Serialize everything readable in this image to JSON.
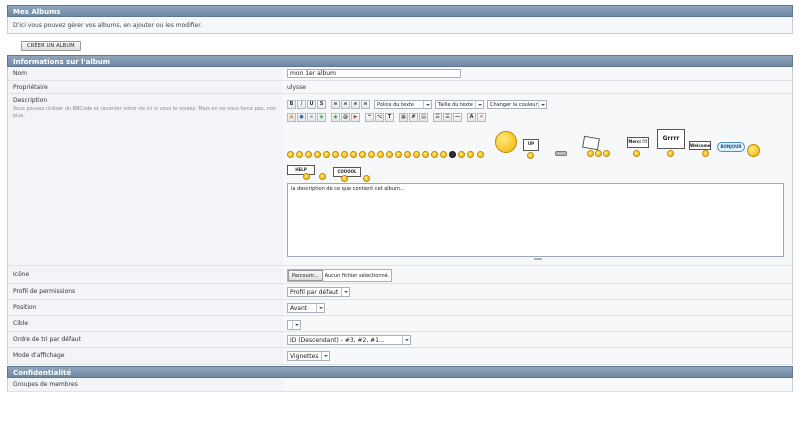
{
  "header": {
    "title": "Mes Albums",
    "intro": "D'ici vous pouvez gérer vos albums, en ajouter ou les modifier."
  },
  "toolbar": {
    "create_label": "CRÉER UN ALBUM"
  },
  "info_section": {
    "title": "Informations sur l'album"
  },
  "fields": {
    "name": {
      "label": "Nom",
      "value": "mon 1er album"
    },
    "owner": {
      "label": "Propriétaire",
      "value": "ulysse"
    },
    "description": {
      "label": "Description",
      "hint": "Vous pouvez utiliser du BBCode et raconter votre vie ici si vous le voulez. Mais on ne vous force pas, non plus.",
      "value": "la description de ce que contient cet album...",
      "font_select": "Police du texte",
      "size_select": "Taille du texte",
      "color_select": "Changer la couleur"
    },
    "icon": {
      "label": "Icône",
      "browse_label": "Parcourir...",
      "file_status": "Aucun fichier sélectionné."
    },
    "permissions": {
      "label": "Profil de permissions",
      "value": "Profil par défaut"
    },
    "position": {
      "label": "Position",
      "value": "Avant"
    },
    "target": {
      "label": "Cible",
      "value": ""
    },
    "sort": {
      "label": "Ordre de tri par défaut",
      "value": "ID (Descendant) - #3, #2, #1..."
    },
    "display": {
      "label": "Mode d'affichage",
      "value": "Vignettes"
    }
  },
  "privacy_section": {
    "title": "Confidentialité"
  },
  "privacy": {
    "groups_label": "Groupes de membres"
  },
  "smiley_signs": {
    "help": "HELP",
    "coool": "COOOOL",
    "up": "UP",
    "merci": "Merci !!!",
    "grrrr": "Grrrr",
    "welcome": "Welcome",
    "bonjour": "BONJOUR"
  }
}
